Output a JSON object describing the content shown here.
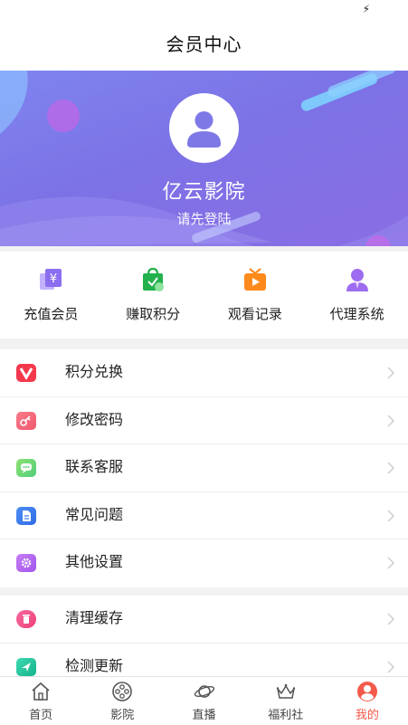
{
  "header": {
    "title": "会员中心"
  },
  "profile": {
    "brand_name": "亿云影院",
    "login_prompt": "请先登陆"
  },
  "quick_actions": [
    {
      "label": "充值会员",
      "icon": "recharge-icon",
      "color": "#8b6ff0"
    },
    {
      "label": "赚取积分",
      "icon": "shopping-bag-icon",
      "color": "#22b14c"
    },
    {
      "label": "观看记录",
      "icon": "tv-play-icon",
      "color": "#ff8a1c"
    },
    {
      "label": "代理系统",
      "icon": "agent-person-icon",
      "color": "#9d6cf0"
    }
  ],
  "menu_group_1": [
    {
      "label": "积分兑换",
      "icon": "v-badge-icon",
      "color": "#f4384c"
    },
    {
      "label": "修改密码",
      "icon": "key-icon",
      "color": "#f36a7c"
    },
    {
      "label": "联系客服",
      "icon": "chat-icon",
      "color": "#6fd66a"
    },
    {
      "label": "常见问题",
      "icon": "document-icon",
      "color": "#3d7cf0"
    },
    {
      "label": "其他设置",
      "icon": "gear-icon",
      "color": "#b466f0"
    }
  ],
  "menu_group_2": [
    {
      "label": "清理缓存",
      "icon": "trash-icon",
      "color": "#f24e8b"
    },
    {
      "label": "检测更新",
      "icon": "send-arrow-icon",
      "color": "#22c59e"
    }
  ],
  "tabbar": [
    {
      "label": "首页",
      "icon": "home-icon",
      "active": false
    },
    {
      "label": "影院",
      "icon": "film-reel-icon",
      "active": false
    },
    {
      "label": "直播",
      "icon": "planet-icon",
      "active": false
    },
    {
      "label": "福利社",
      "icon": "crown-icon",
      "active": false
    },
    {
      "label": "我的",
      "icon": "user-circle-icon",
      "active": true
    }
  ],
  "colors": {
    "accent": "#f25a4b",
    "banner_start": "#7f84ef",
    "banner_end": "#8a6de3"
  }
}
